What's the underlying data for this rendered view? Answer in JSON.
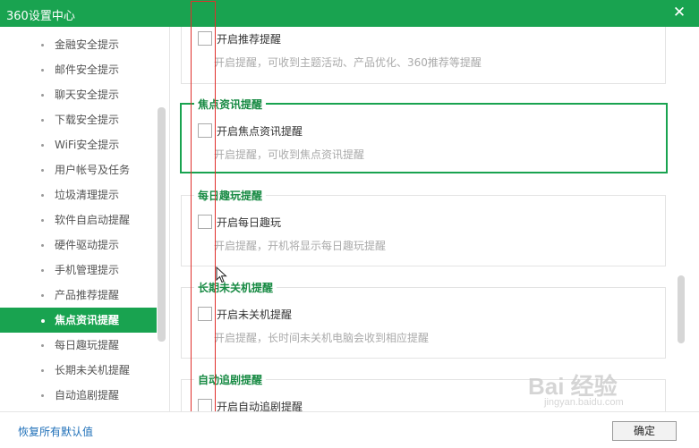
{
  "window": {
    "title": "360设置中心",
    "close_glyph": "✕"
  },
  "sidebar": {
    "items": [
      {
        "label": "金融安全提示",
        "active": false
      },
      {
        "label": "邮件安全提示",
        "active": false
      },
      {
        "label": "聊天安全提示",
        "active": false
      },
      {
        "label": "下载安全提示",
        "active": false
      },
      {
        "label": "WiFi安全提示",
        "active": false
      },
      {
        "label": "用户帐号及任务",
        "active": false
      },
      {
        "label": "垃圾清理提示",
        "active": false
      },
      {
        "label": "软件自启动提醒",
        "active": false
      },
      {
        "label": "硬件驱动提示",
        "active": false
      },
      {
        "label": "手机管理提示",
        "active": false
      },
      {
        "label": "产品推荐提醒",
        "active": false
      },
      {
        "label": "焦点资讯提醒",
        "active": true
      },
      {
        "label": "每日趣玩提醒",
        "active": false
      },
      {
        "label": "长期未关机提醒",
        "active": false
      },
      {
        "label": "自动追剧提醒",
        "active": false
      }
    ]
  },
  "groups": [
    {
      "legend": "",
      "checkbox_label": "开启推荐提醒",
      "checked": false,
      "description": "开启提醒，可收到主题活动、产品优化、360推荐等提醒"
    },
    {
      "legend": "焦点资讯提醒",
      "checkbox_label": "开启焦点资讯提醒",
      "checked": false,
      "description": "开启提醒，可收到焦点资讯提醒"
    },
    {
      "legend": "每日趣玩提醒",
      "checkbox_label": "开启每日趣玩",
      "checked": false,
      "description": "开启提醒，开机将显示每日趣玩提醒"
    },
    {
      "legend": "长期未关机提醒",
      "checkbox_label": "开启未关机提醒",
      "checked": false,
      "description": "开启提醒，长时间未关机电脑会收到相应提醒"
    },
    {
      "legend": "自动追剧提醒",
      "checkbox_label": "开启自动追剧提醒",
      "checked": false,
      "description": ""
    }
  ],
  "footer": {
    "reset_label": "恢复所有默认值",
    "ok_label": "确定"
  },
  "watermark": {
    "text": "Bai 经验",
    "subtext": "jingyan.baidu.com"
  },
  "colors": {
    "accent": "#19a350",
    "annotation": "#e0302c",
    "link": "#1e6fb8"
  }
}
